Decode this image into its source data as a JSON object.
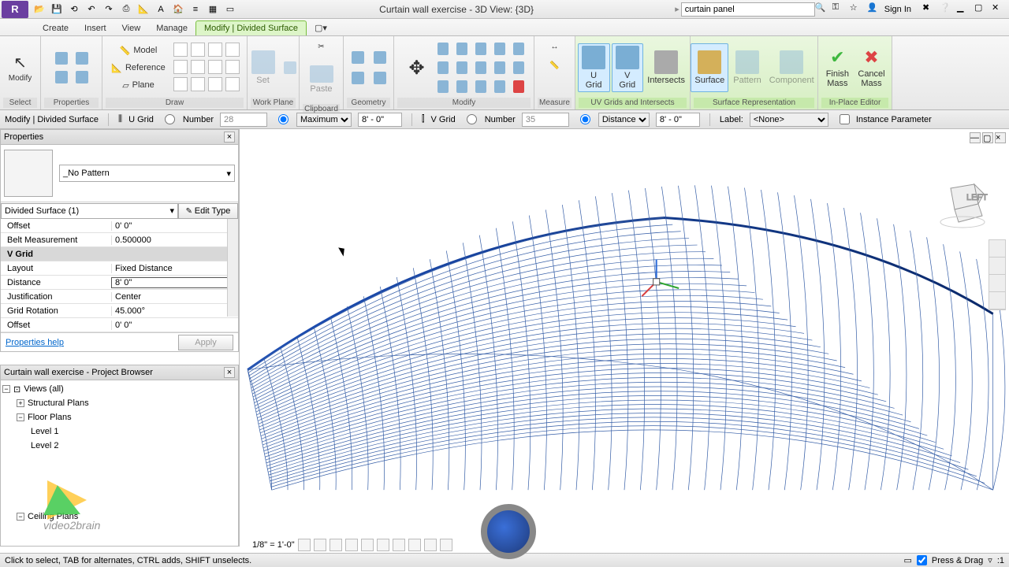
{
  "title_bar": {
    "title": "Curtain wall exercise - 3D View: {3D}",
    "search_text": "curtain panel",
    "sign_in": "Sign In"
  },
  "menu": {
    "tabs": [
      "Create",
      "Insert",
      "View",
      "Manage",
      "Modify | Divided Surface"
    ],
    "active": 4
  },
  "ribbon": {
    "select": "Select",
    "properties": "Properties",
    "draw": {
      "label": "Draw",
      "model": "Model",
      "reference": "Reference",
      "plane": "Plane"
    },
    "work_plane": {
      "label": "Work Plane",
      "set": "Set"
    },
    "clipboard": {
      "label": "Clipboard",
      "paste": "Paste"
    },
    "geometry": "Geometry",
    "modify": "Modify",
    "measure": "Measure",
    "uv": {
      "label": "UV Grids and Intersects",
      "u": "U Grid",
      "v": "V Grid",
      "intersects": "Intersects"
    },
    "surf_rep": {
      "label": "Surface Representation",
      "surface": "Surface",
      "pattern": "Pattern",
      "component": "Component"
    },
    "editor": {
      "label": "In-Place Editor",
      "finish": "Finish\nMass",
      "cancel": "Cancel\nMass"
    }
  },
  "options": {
    "context": "Modify | Divided Surface",
    "u_grid": "U Grid",
    "number": "Number",
    "u_number": "28",
    "maximum": "Maximum",
    "u_spacing": "8' - 0\"",
    "v_grid": "V Grid",
    "v_number": "35",
    "distance": "Distance",
    "v_spacing": "8' - 0\"",
    "label": "Label:",
    "label_value": "<None>",
    "instance_param": "Instance Parameter"
  },
  "props_panel": {
    "title": "Properties",
    "pattern": "_No Pattern",
    "instance": "Divided Surface (1)",
    "edit_type": "Edit Type",
    "rows": [
      {
        "name": "Offset",
        "value": "0'  0\""
      },
      {
        "name": "Belt Measurement",
        "value": "0.500000"
      },
      {
        "name": "V Grid",
        "value": "",
        "section": true
      },
      {
        "name": "Layout",
        "value": "Fixed Distance"
      },
      {
        "name": "Distance",
        "value": "8'  0\"",
        "editing": true
      },
      {
        "name": "Justification",
        "value": "Center"
      },
      {
        "name": "Grid Rotation",
        "value": "45.000°"
      },
      {
        "name": "Offset",
        "value": "0'  0\""
      }
    ],
    "help": "Properties help",
    "apply": "Apply"
  },
  "browser": {
    "title": "Curtain wall exercise - Project Browser",
    "views": "Views (all)",
    "items": [
      "Structural Plans",
      "Floor Plans",
      "Level 1",
      "Level 2",
      "Ceiling Plans"
    ]
  },
  "view_status": {
    "scale": "1/8\" = 1'-0\""
  },
  "status_bar": {
    "hint": "Click to select, TAB for alternates, CTRL adds, SHIFT unselects.",
    "press_drag": "Press & Drag",
    "filter": ":1"
  },
  "watermark": "video2brain"
}
